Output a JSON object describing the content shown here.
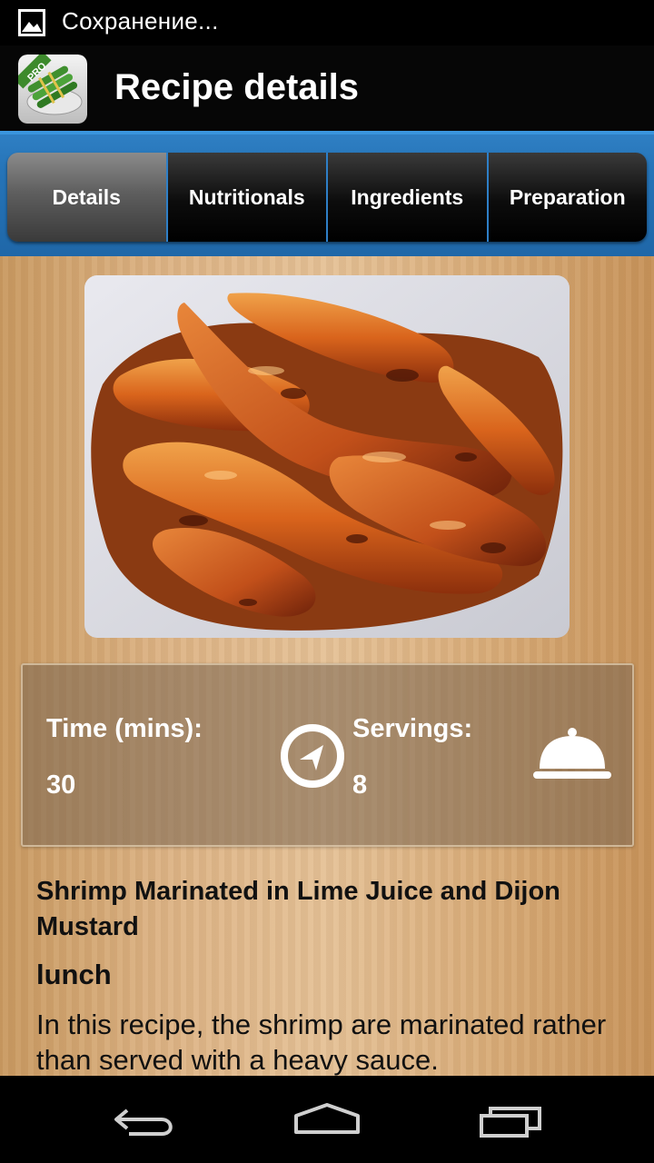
{
  "status_bar": {
    "text": "Сохранение...",
    "icon": "image-icon"
  },
  "action_bar": {
    "title": "Recipe details",
    "app_icon": "app-logo-icon",
    "app_badge": "PRO"
  },
  "tabs": [
    {
      "label": "Details",
      "active": true
    },
    {
      "label": "Nutritionals",
      "active": false
    },
    {
      "label": "Ingredients",
      "active": false
    },
    {
      "label": "Preparation",
      "active": false
    }
  ],
  "recipe": {
    "photo": "glazed-chicken-wings-photo",
    "time_label": "Time (mins):",
    "time_value": "30",
    "servings_label": "Servings:",
    "servings_value": "8",
    "title": "Shrimp Marinated in Lime Juice and Dijon Mustard",
    "category": "lunch",
    "description": "In this recipe, the shrimp are marinated rather than served with a heavy sauce."
  },
  "nav_bar": {
    "back": "back-icon",
    "home": "home-icon",
    "recents": "recents-icon"
  },
  "colors": {
    "tab_bar_blue": "#2574b8",
    "active_tab": "#6a6a6a",
    "wood": "#ddb486"
  }
}
